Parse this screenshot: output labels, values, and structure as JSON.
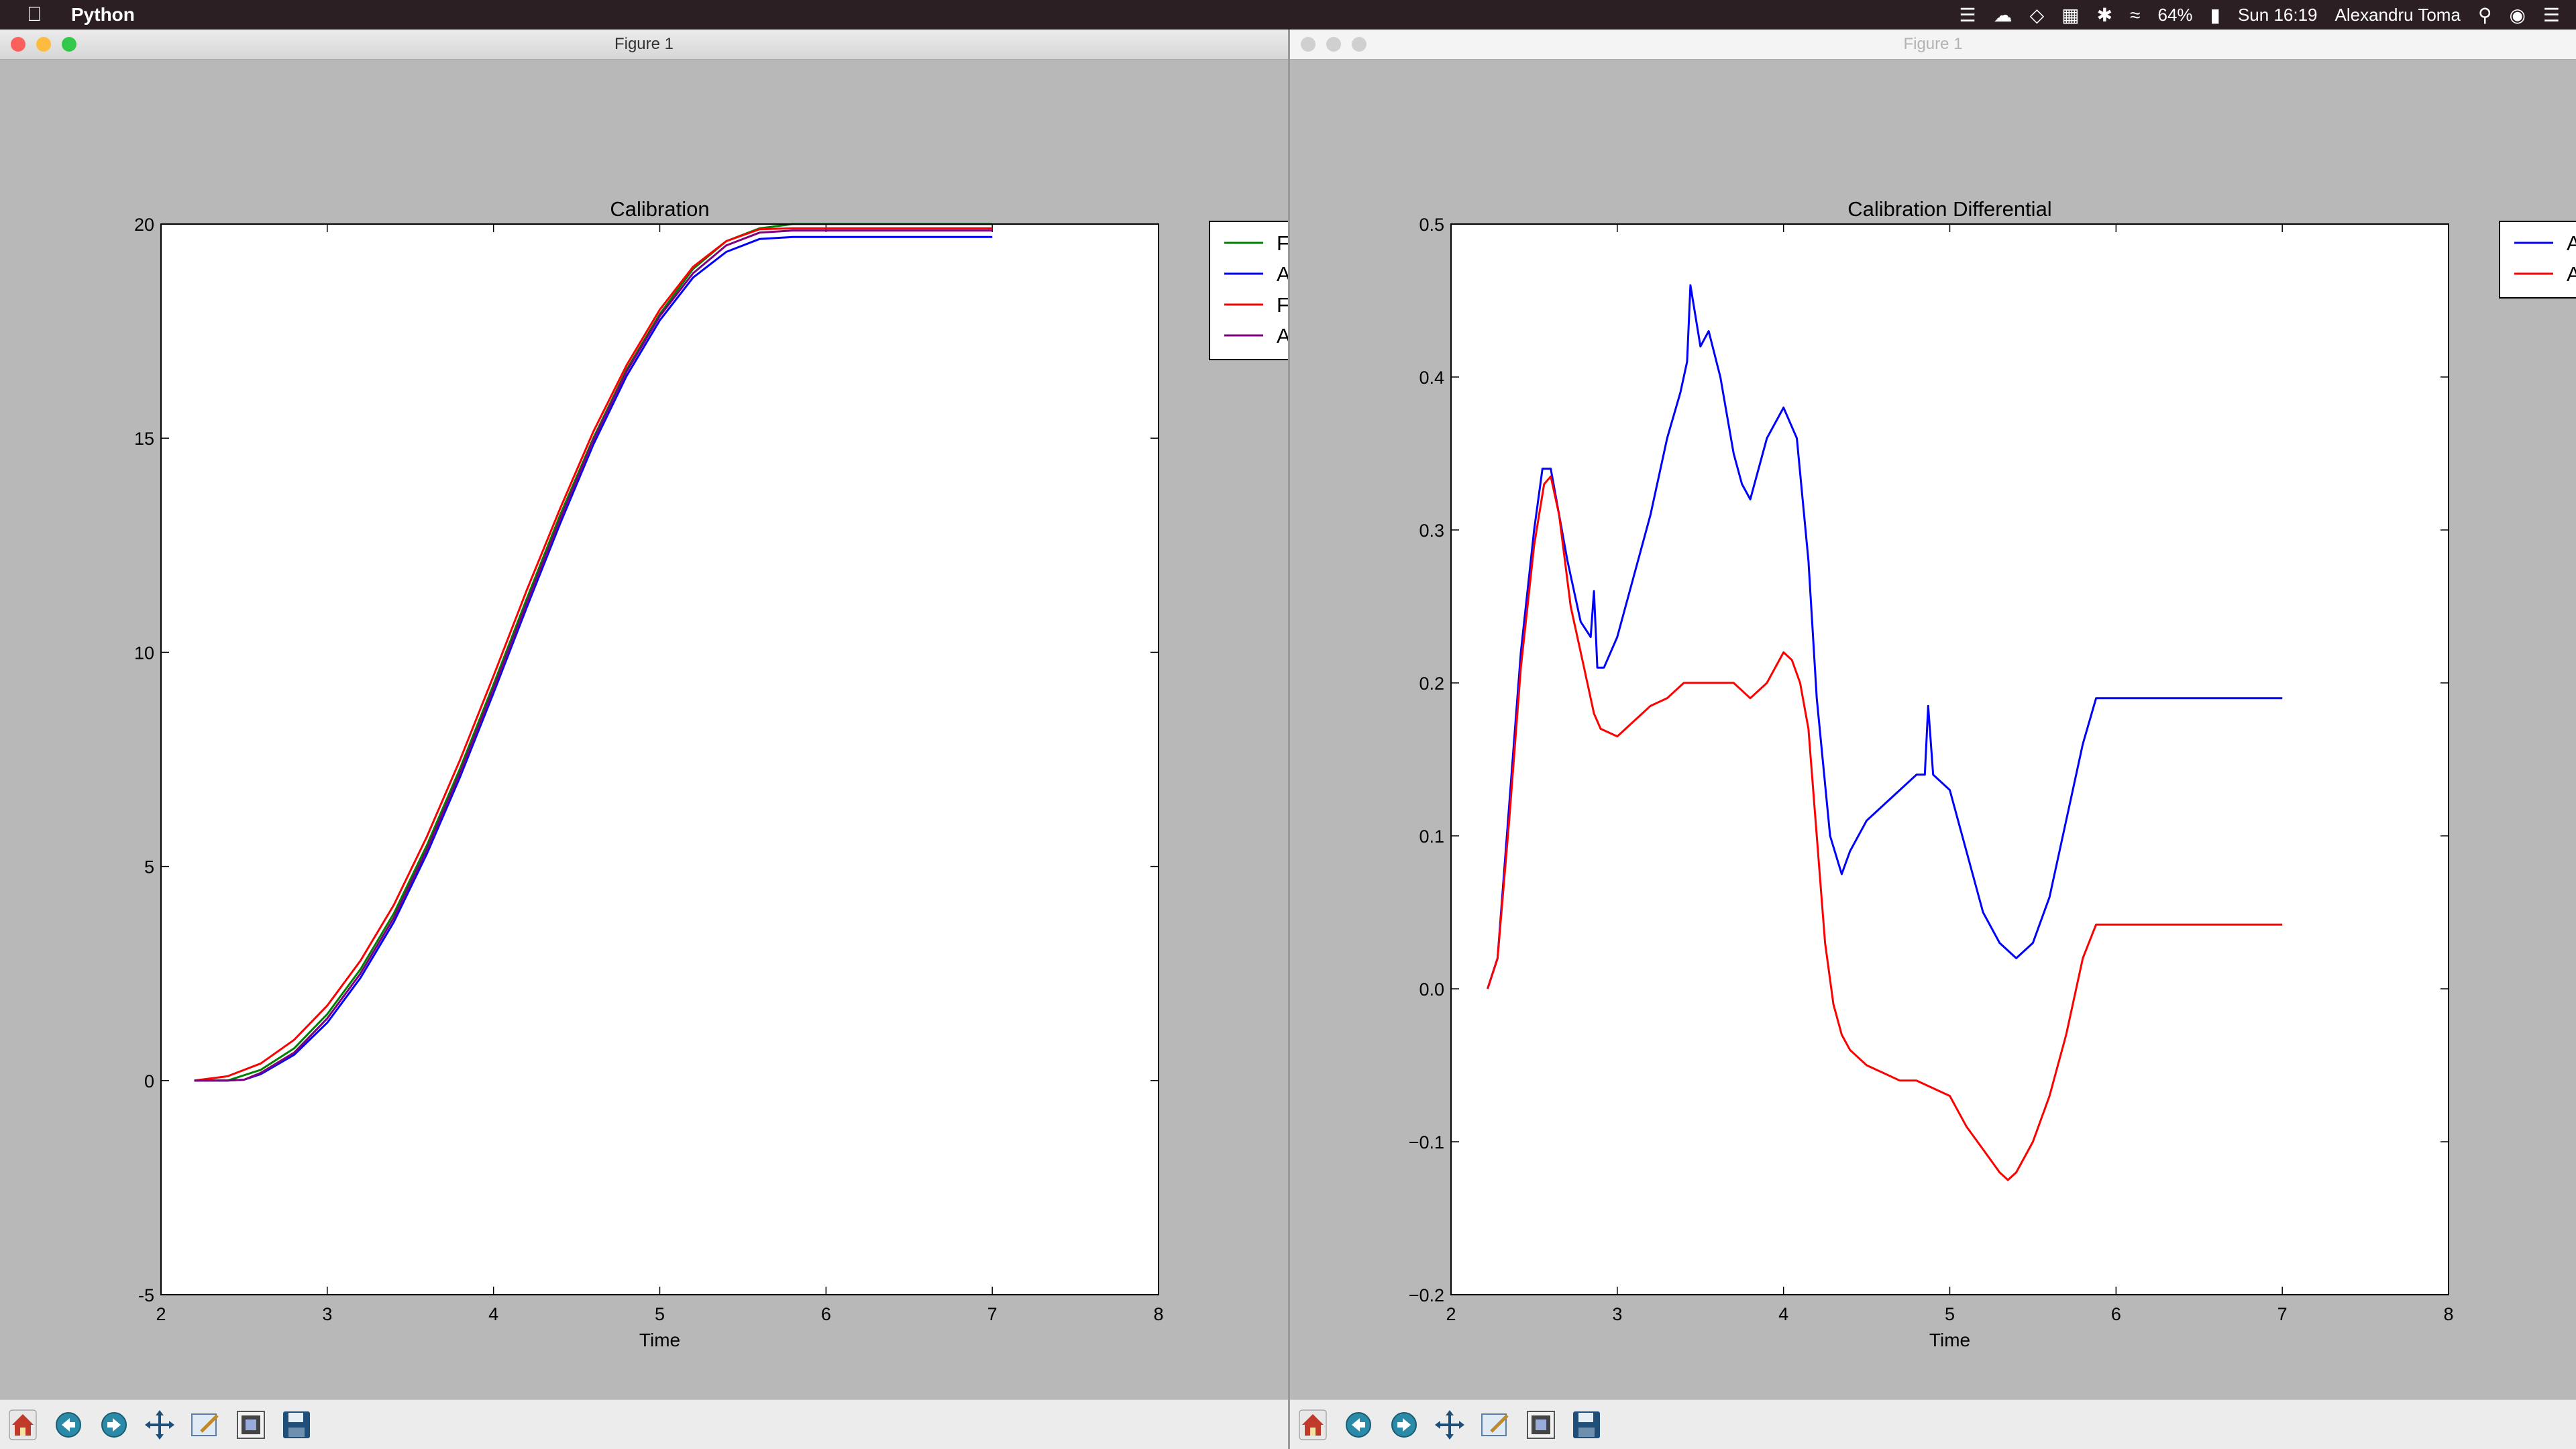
{
  "menubar": {
    "app_name": "Python",
    "battery": "64%",
    "clock": "Sun 16:19",
    "user": "Alexandru Toma"
  },
  "colors": {
    "green": "#008000",
    "blue": "#0000ff",
    "red": "#ff0000",
    "purple": "#800080",
    "canvas": "#b8b8b8"
  },
  "toolbar_icons": [
    "home-icon",
    "back-arrow-icon",
    "forward-arrow-icon",
    "pan-move-icon",
    "zoom-rect-icon",
    "configure-subplots-icon",
    "save-floppy-icon"
  ],
  "windows": [
    {
      "title": "Figure 1",
      "chart_data": {
        "type": "line",
        "title": "Calibration",
        "xlabel": "Time",
        "ylabel": "",
        "xlim": [
          2,
          8
        ],
        "ylim": [
          -5,
          20
        ],
        "xticks": [
          2,
          3,
          4,
          5,
          6,
          7,
          8
        ],
        "yticks": [
          -5,
          0,
          5,
          10,
          15,
          20
        ],
        "grid": false,
        "legend_position": "right-outside-top",
        "series": [
          {
            "name": "F",
            "color": "#008000",
            "x": [
              2.2,
              2.4,
              2.6,
              2.8,
              3.0,
              3.2,
              3.4,
              3.6,
              3.8,
              4.0,
              4.2,
              4.4,
              4.6,
              4.8,
              5.0,
              5.2,
              5.4,
              5.6,
              5.8,
              6.0,
              6.5,
              7.0
            ],
            "y": [
              0,
              0.0,
              0.25,
              0.75,
              1.55,
              2.6,
              3.9,
              5.5,
              7.3,
              9.25,
              11.25,
              13.2,
              15.0,
              16.6,
              17.9,
              18.95,
              19.6,
              19.9,
              20.0,
              20.0,
              20.0,
              20.0
            ]
          },
          {
            "name": "A",
            "color": "#0000ff",
            "x": [
              2.2,
              2.4,
              2.5,
              2.6,
              2.8,
              3.0,
              3.2,
              3.4,
              3.6,
              3.8,
              4.0,
              4.2,
              4.4,
              4.6,
              4.8,
              5.0,
              5.2,
              5.4,
              5.6,
              5.8,
              6.0,
              6.5,
              7.0
            ],
            "y": [
              0,
              0,
              0.02,
              0.15,
              0.6,
              1.35,
              2.4,
              3.7,
              5.3,
              7.1,
              9.05,
              11.05,
              13.0,
              14.85,
              16.45,
              17.75,
              18.75,
              19.35,
              19.65,
              19.7,
              19.7,
              19.7,
              19.7
            ]
          },
          {
            "name": "F",
            "color": "#ff0000",
            "x": [
              2.2,
              2.4,
              2.6,
              2.8,
              3.0,
              3.2,
              3.4,
              3.6,
              3.8,
              4.0,
              4.2,
              4.4,
              4.6,
              4.8,
              5.0,
              5.2,
              5.4,
              5.6,
              5.8,
              6.0,
              6.5,
              7.0
            ],
            "y": [
              0,
              0.1,
              0.4,
              0.95,
              1.75,
              2.8,
              4.1,
              5.7,
              7.5,
              9.45,
              11.45,
              13.35,
              15.15,
              16.7,
              18.0,
              19.0,
              19.6,
              19.88,
              19.9,
              19.9,
              19.9,
              19.9
            ]
          },
          {
            "name": "A",
            "color": "#800080",
            "x": [
              2.2,
              2.4,
              2.5,
              2.6,
              2.8,
              3.0,
              3.2,
              3.4,
              3.6,
              3.8,
              4.0,
              4.2,
              4.4,
              4.6,
              4.8,
              5.0,
              5.2,
              5.4,
              5.6,
              5.8,
              6.0,
              6.5,
              7.0
            ],
            "y": [
              0,
              0,
              0.02,
              0.18,
              0.65,
              1.45,
              2.5,
              3.8,
              5.4,
              7.2,
              9.15,
              11.15,
              13.1,
              14.95,
              16.55,
              17.85,
              18.85,
              19.5,
              19.8,
              19.85,
              19.85,
              19.85,
              19.85
            ]
          }
        ]
      }
    },
    {
      "title": "Figure 1",
      "chart_data": {
        "type": "line",
        "title": "Calibration Differential",
        "xlabel": "Time",
        "ylabel": "",
        "xlim": [
          2,
          8
        ],
        "ylim": [
          -0.2,
          0.5
        ],
        "xticks": [
          2,
          3,
          4,
          5,
          6,
          7,
          8
        ],
        "yticks": [
          -0.2,
          -0.1,
          0.0,
          0.1,
          0.2,
          0.3,
          0.4,
          0.5
        ],
        "ytick_labels": [
          "−0.2",
          "−0.1",
          "0.0",
          "0.1",
          "0.2",
          "0.3",
          "0.4",
          "0.5"
        ],
        "grid": false,
        "legend_position": "right-outside-top",
        "series": [
          {
            "name": "A",
            "color": "#0000ff",
            "x": [
              2.22,
              2.28,
              2.35,
              2.42,
              2.5,
              2.55,
              2.6,
              2.65,
              2.7,
              2.78,
              2.84,
              2.86,
              2.88,
              2.92,
              3.0,
              3.1,
              3.2,
              3.3,
              3.38,
              3.42,
              3.44,
              3.5,
              3.55,
              3.62,
              3.7,
              3.75,
              3.8,
              3.9,
              4.0,
              4.08,
              4.15,
              4.2,
              4.28,
              4.35,
              4.4,
              4.5,
              4.6,
              4.7,
              4.8,
              4.85,
              4.87,
              4.9,
              5.0,
              5.1,
              5.2,
              5.3,
              5.4,
              5.5,
              5.6,
              5.7,
              5.8,
              5.88,
              6.0,
              6.5,
              7.0
            ],
            "y": [
              0.0,
              0.02,
              0.12,
              0.22,
              0.3,
              0.34,
              0.34,
              0.31,
              0.28,
              0.24,
              0.23,
              0.26,
              0.21,
              0.21,
              0.23,
              0.27,
              0.31,
              0.36,
              0.39,
              0.41,
              0.46,
              0.42,
              0.43,
              0.4,
              0.35,
              0.33,
              0.32,
              0.36,
              0.38,
              0.36,
              0.28,
              0.19,
              0.1,
              0.075,
              0.09,
              0.11,
              0.12,
              0.13,
              0.14,
              0.14,
              0.185,
              0.14,
              0.13,
              0.09,
              0.05,
              0.03,
              0.02,
              0.03,
              0.06,
              0.11,
              0.16,
              0.19,
              0.19,
              0.19,
              0.19
            ]
          },
          {
            "name": "A",
            "color": "#ff0000",
            "x": [
              2.22,
              2.28,
              2.35,
              2.42,
              2.5,
              2.56,
              2.6,
              2.65,
              2.72,
              2.8,
              2.86,
              2.9,
              3.0,
              3.1,
              3.2,
              3.3,
              3.4,
              3.5,
              3.6,
              3.7,
              3.8,
              3.9,
              4.0,
              4.05,
              4.1,
              4.15,
              4.2,
              4.25,
              4.3,
              4.35,
              4.4,
              4.5,
              4.6,
              4.7,
              4.8,
              4.9,
              5.0,
              5.1,
              5.2,
              5.3,
              5.35,
              5.4,
              5.5,
              5.6,
              5.7,
              5.8,
              5.88,
              6.0,
              6.5,
              7.0
            ],
            "y": [
              0.0,
              0.02,
              0.11,
              0.21,
              0.29,
              0.33,
              0.335,
              0.31,
              0.25,
              0.21,
              0.18,
              0.17,
              0.165,
              0.175,
              0.185,
              0.19,
              0.2,
              0.2,
              0.2,
              0.2,
              0.19,
              0.2,
              0.22,
              0.215,
              0.2,
              0.17,
              0.1,
              0.03,
              -0.01,
              -0.03,
              -0.04,
              -0.05,
              -0.055,
              -0.06,
              -0.06,
              -0.065,
              -0.07,
              -0.09,
              -0.105,
              -0.12,
              -0.125,
              -0.12,
              -0.1,
              -0.07,
              -0.03,
              0.02,
              0.042,
              0.042,
              0.042,
              0.042
            ]
          }
        ]
      }
    }
  ]
}
